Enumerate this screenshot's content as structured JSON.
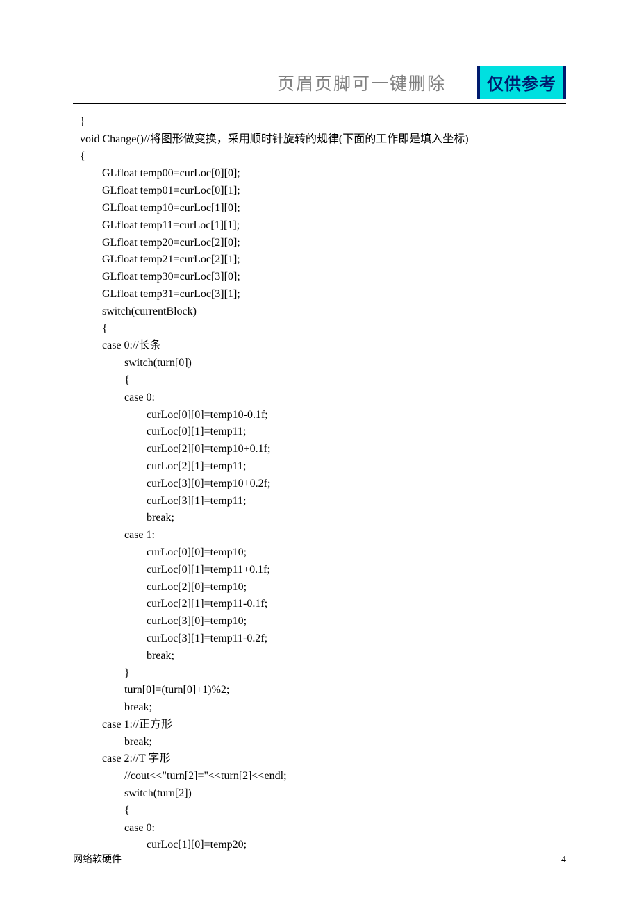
{
  "header": {
    "title": "页眉页脚可一键删除",
    "badge": "仅供参考"
  },
  "code": {
    "lines": [
      "}",
      "void Change()//将图形做变换，采用顺时针旋转的规律(下面的工作即是填入坐标)",
      "{",
      "        GLfloat temp00=curLoc[0][0];",
      "        GLfloat temp01=curLoc[0][1];",
      "        GLfloat temp10=curLoc[1][0];",
      "        GLfloat temp11=curLoc[1][1];",
      "        GLfloat temp20=curLoc[2][0];",
      "        GLfloat temp21=curLoc[2][1];",
      "        GLfloat temp30=curLoc[3][0];",
      "        GLfloat temp31=curLoc[3][1];",
      "        switch(currentBlock)",
      "        {",
      "        case 0://长条",
      "                switch(turn[0])",
      "                {",
      "                case 0:",
      "                        curLoc[0][0]=temp10-0.1f;",
      "                        curLoc[0][1]=temp11;",
      "                        curLoc[2][0]=temp10+0.1f;",
      "                        curLoc[2][1]=temp11;",
      "                        curLoc[3][0]=temp10+0.2f;",
      "                        curLoc[3][1]=temp11;",
      "                        break;",
      "                case 1:",
      "                        curLoc[0][0]=temp10;",
      "                        curLoc[0][1]=temp11+0.1f;",
      "                        curLoc[2][0]=temp10;",
      "                        curLoc[2][1]=temp11-0.1f;",
      "                        curLoc[3][0]=temp10;",
      "                        curLoc[3][1]=temp11-0.2f;",
      "                        break;",
      "                }",
      "                turn[0]=(turn[0]+1)%2;",
      "                break;",
      "        case 1://正方形",
      "                break;",
      "        case 2://T 字形",
      "                //cout<<\"turn[2]=\"<<turn[2]<<endl;",
      "                switch(turn[2])",
      "                {",
      "                case 0:",
      "                        curLoc[1][0]=temp20;"
    ]
  },
  "footer": {
    "left": "网络软硬件",
    "page": "4"
  }
}
